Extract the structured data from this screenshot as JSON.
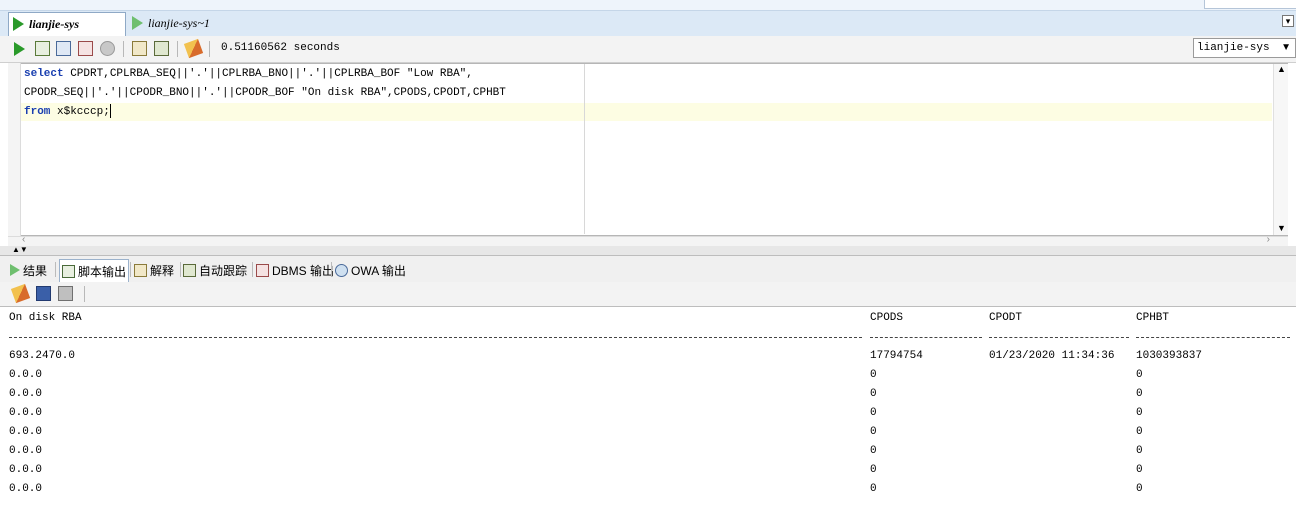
{
  "tabs": {
    "active": "lianjie-sys",
    "inactive": "lianjie-sys~1"
  },
  "toolbar": {
    "elapsed": "0.51160562 seconds",
    "connection": "lianjie-sys"
  },
  "editor": {
    "lines": [
      {
        "kw": "select",
        "rest": " CPDRT,CPLRBA_SEQ||'.'||CPLRBA_BNO||'.'||CPLRBA_BOF \"Low RBA\","
      },
      {
        "kw": "",
        "rest": "CPODR_SEQ||'.'||CPODR_BNO||'.'||CPODR_BOF \"On disk RBA\",CPODS,CPODT,CPHBT"
      },
      {
        "kw": "from",
        "rest": " x$kcccp;"
      }
    ]
  },
  "output_tabs": [
    {
      "label": "结果",
      "icon": "play-icon"
    },
    {
      "label": "脚本输出",
      "icon": "script-output-icon"
    },
    {
      "label": "解释",
      "icon": "explain-plan-icon"
    },
    {
      "label": "自动跟踪",
      "icon": "autotrace-icon"
    },
    {
      "label": "DBMS 输出",
      "icon": "dbms-output-icon"
    },
    {
      "label": "OWA 输出",
      "icon": "owa-output-icon"
    }
  ],
  "results": {
    "headers": [
      "On disk RBA",
      "CPODS",
      "CPODT",
      "CPHBT"
    ],
    "rows": [
      [
        "693.2470.0",
        "17794754",
        "01/23/2020 11:34:36",
        "1030393837"
      ],
      [
        "0.0.0",
        "0",
        "",
        "0"
      ],
      [
        "0.0.0",
        "0",
        "",
        "0"
      ],
      [
        "0.0.0",
        "0",
        "",
        "0"
      ],
      [
        "0.0.0",
        "0",
        "",
        "0"
      ],
      [
        "0.0.0",
        "0",
        "",
        "0"
      ],
      [
        "0.0.0",
        "0",
        "",
        "0"
      ],
      [
        "0.0.0",
        "0",
        "",
        "0"
      ]
    ]
  },
  "colors": {
    "run_green": "#2a9a2a",
    "keyword_blue": "#1a3fb0",
    "current_line": "#fdfde3"
  }
}
